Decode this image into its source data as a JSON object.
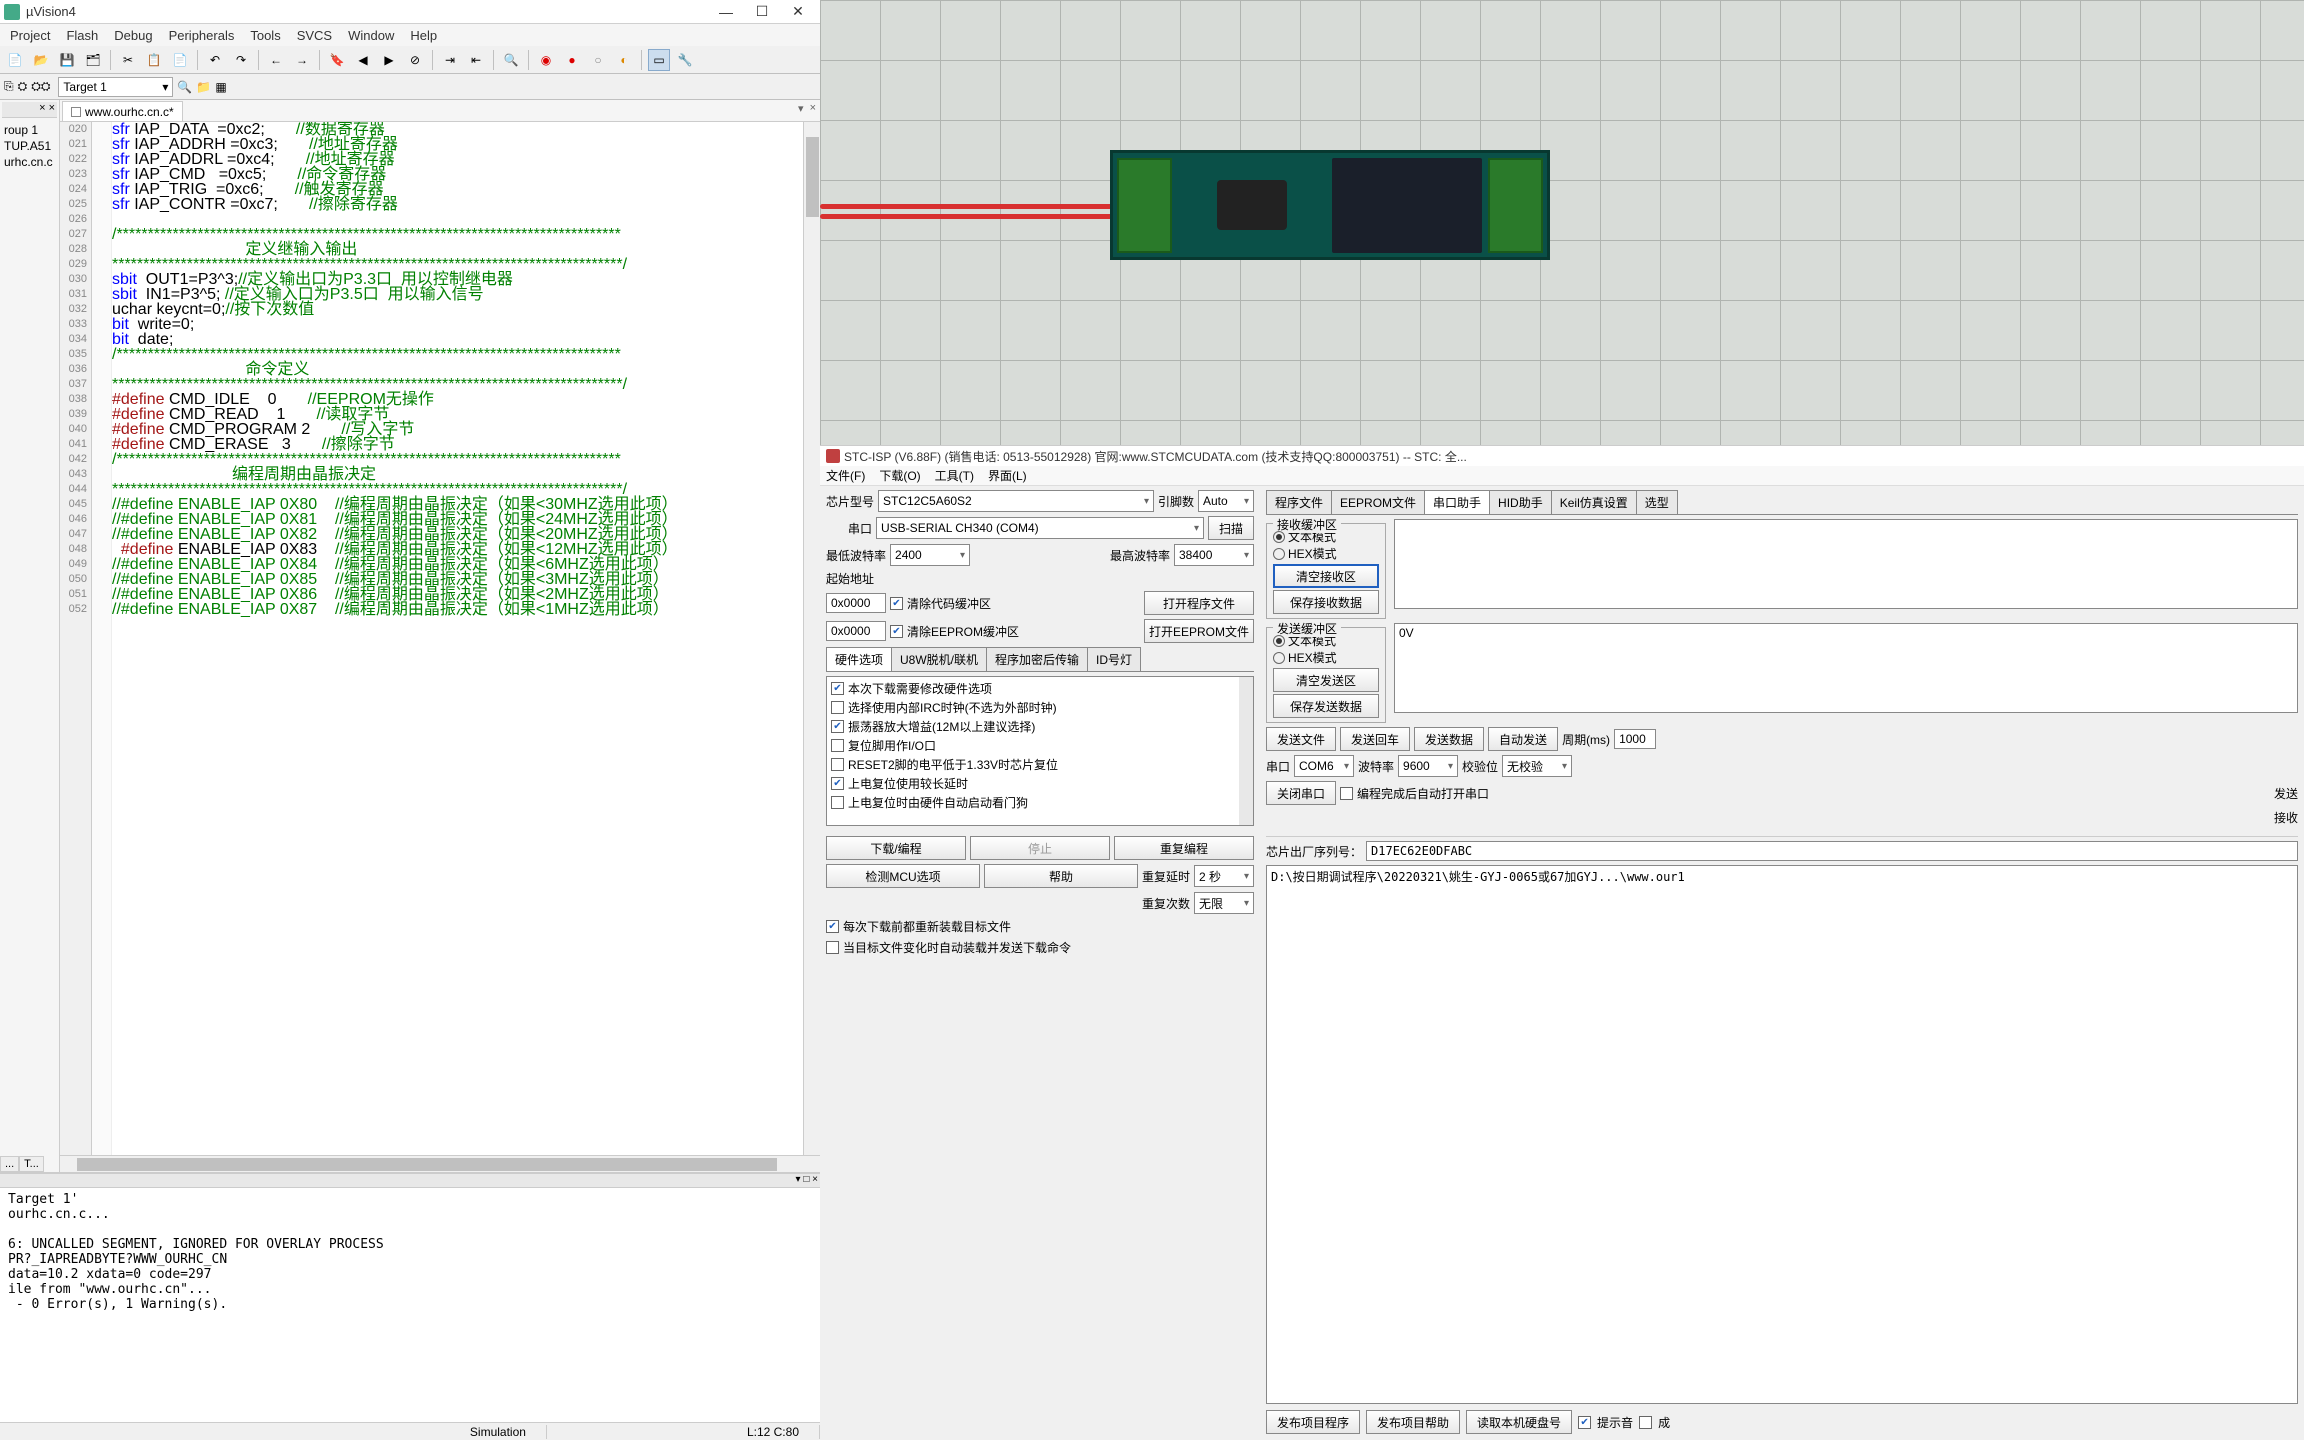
{
  "uvision": {
    "title": "µVision4",
    "menus": [
      "Project",
      "Flash",
      "Debug",
      "Peripherals",
      "Tools",
      "SVCS",
      "Window",
      "Help"
    ],
    "target": "Target 1",
    "editor_tab": "www.ourhc.cn.c*",
    "project_items": [
      "roup 1",
      "TUP.A51",
      "urhc.cn.c"
    ],
    "project_tabs": [
      "...",
      "T..."
    ],
    "code_lines": [
      {
        "n": "020",
        "html": "<span class='kw'>sfr</span> IAP_DATA  =0xc2;       <span class='cm'>//数据寄存器</span>"
      },
      {
        "n": "021",
        "html": "<span class='kw'>sfr</span> IAP_ADDRH =0xc3;       <span class='cm'>//地址寄存器</span>"
      },
      {
        "n": "022",
        "html": "<span class='kw'>sfr</span> IAP_ADDRL =0xc4;       <span class='cm'>//地址寄存器</span>"
      },
      {
        "n": "023",
        "html": "<span class='kw'>sfr</span> IAP_CMD   =0xc5;       <span class='cm'>//命令寄存器</span>"
      },
      {
        "n": "024",
        "html": "<span class='kw'>sfr</span> IAP_TRIG  =0xc6;       <span class='cm'>//触发寄存器</span>"
      },
      {
        "n": "025",
        "html": "<span class='kw'>sfr</span> IAP_CONTR =0xc7;       <span class='cm'>//擦除寄存器</span>"
      },
      {
        "n": "026",
        "html": ""
      },
      {
        "n": "027",
        "html": "<span class='cm'>/*********************************************************************************</span>"
      },
      {
        "n": "028",
        "html": "<span class='cm'>                              定义继输入输出</span>"
      },
      {
        "n": "029",
        "html": "<span class='cm'>**********************************************************************************/</span>"
      },
      {
        "n": "030",
        "html": "<span class='kw'>sbit</span>  OUT1=P3^3;<span class='cm'>//定义输出口为P3.3口  用以控制继电器</span>"
      },
      {
        "n": "031",
        "html": "<span class='kw'>sbit</span>  IN1=P3^5; <span class='cm'>//定义输入口为P3.5口  用以输入信号</span>"
      },
      {
        "n": "032",
        "html": "uchar keycnt=0;<span class='cm'>//按下次数值</span>"
      },
      {
        "n": "033",
        "html": "<span class='kw'>bit</span>  write=0;"
      },
      {
        "n": "034",
        "html": "<span class='kw'>bit</span>  date;"
      },
      {
        "n": "035",
        "html": "<span class='cm'>/*********************************************************************************</span>"
      },
      {
        "n": "036",
        "html": "<span class='cm'>                              命令定义</span>"
      },
      {
        "n": "037",
        "html": "<span class='cm'>**********************************************************************************/</span>"
      },
      {
        "n": "038",
        "html": "<span class='pp'>#define</span> CMD_IDLE    0       <span class='cm'>//EEPROM无操作</span>"
      },
      {
        "n": "039",
        "html": "<span class='pp'>#define</span> CMD_READ    1       <span class='cm'>//读取字节</span>"
      },
      {
        "n": "040",
        "html": "<span class='pp'>#define</span> CMD_PROGRAM 2       <span class='cm'>//写入字节</span>"
      },
      {
        "n": "041",
        "html": "<span class='pp'>#define</span> CMD_ERASE   3       <span class='cm'>//擦除字节</span>"
      },
      {
        "n": "042",
        "html": "<span class='cm'>/*********************************************************************************</span>"
      },
      {
        "n": "043",
        "html": "<span class='cm'>                           编程周期由晶振决定</span>"
      },
      {
        "n": "044",
        "html": "<span class='cm'>**********************************************************************************/</span>"
      },
      {
        "n": "045",
        "html": "<span class='cm'>//#define ENABLE_IAP 0X80    //编程周期由晶振决定（如果&lt;30MHZ选用此项）</span>"
      },
      {
        "n": "046",
        "html": "<span class='cm'>//#define ENABLE_IAP 0X81    //编程周期由晶振决定（如果&lt;24MHZ选用此项）</span>"
      },
      {
        "n": "047",
        "html": "<span class='cm'>//#define ENABLE_IAP 0X82    //编程周期由晶振决定（如果&lt;20MHZ选用此项）</span>"
      },
      {
        "n": "048",
        "html": "  <span class='pp'>#define</span> ENABLE_IAP 0X83    <span class='cm'>//编程周期由晶振决定（如果&lt;12MHZ选用此项）</span>"
      },
      {
        "n": "049",
        "html": "<span class='cm'>//#define ENABLE_IAP 0X84    //编程周期由晶振决定（如果&lt;6MHZ选用此项）</span>"
      },
      {
        "n": "050",
        "html": "<span class='cm'>//#define ENABLE_IAP 0X85    //编程周期由晶振决定（如果&lt;3MHZ选用此项）</span>"
      },
      {
        "n": "051",
        "html": "<span class='cm'>//#define ENABLE_IAP 0X86    //编程周期由晶振决定（如果&lt;2MHZ选用此项）</span>"
      },
      {
        "n": "052",
        "html": "<span class='cm'>//#define ENABLE_IAP 0X87    //编程周期由晶振决定（如果&lt;1MHZ选用此项）</span>"
      }
    ],
    "output": "Target 1'\nourhc.cn.c...\n\n6: UNCALLED SEGMENT, IGNORED FOR OVERLAY PROCESS\nPR?_IAPREADBYTE?WWW_OURHC_CN\ndata=10.2 xdata=0 code=297\nile from \"www.ourhc.cn\"...\n - 0 Error(s), 1 Warning(s).",
    "status_sim": "Simulation",
    "status_pos": "L:12 C:80"
  },
  "stc": {
    "title": "STC-ISP (V6.88F) (销售电话: 0513-55012928) 官网:www.STCMCUDATA.com  (技术支持QQ:800003751) -- STC: 全...",
    "menus": [
      "文件(F)",
      "下载(O)",
      "工具(T)",
      "界面(L)"
    ],
    "chip_label": "芯片型号",
    "chip_value": "STC12C5A60S2",
    "pin_label": "引脚数",
    "pin_value": "Auto",
    "port_label": "串口",
    "port_value": "USB-SERIAL CH340 (COM4)",
    "scan_btn": "扫描",
    "minbaud_label": "最低波特率",
    "minbaud_value": "2400",
    "maxbaud_label": "最高波特率",
    "maxbaud_value": "38400",
    "startaddr_label": "起始地址",
    "addr1": "0x0000",
    "clear_code": "清除代码缓冲区",
    "open_code_btn": "打开程序文件",
    "addr2": "0x0000",
    "clear_eeprom": "清除EEPROM缓冲区",
    "open_eeprom_btn": "打开EEPROM文件",
    "hw_tabs": [
      "硬件选项",
      "U8W脱机/联机",
      "程序加密后传输",
      "ID号灯"
    ],
    "hw_opts": [
      {
        "c": true,
        "t": "本次下载需要修改硬件选项"
      },
      {
        "c": false,
        "t": "选择使用内部IRC时钟(不选为外部时钟)"
      },
      {
        "c": true,
        "t": "振荡器放大增益(12M以上建议选择)"
      },
      {
        "c": false,
        "t": "复位脚用作I/O口"
      },
      {
        "c": false,
        "t": "RESET2脚的电平低于1.33V时芯片复位"
      },
      {
        "c": true,
        "t": "上电复位使用较长延时"
      },
      {
        "c": false,
        "t": "上电复位时由硬件自动启动看门狗"
      }
    ],
    "dl_btn": "下载/编程",
    "stop_btn": "停止",
    "reprg_btn": "重复编程",
    "detect_btn": "检测MCU选项",
    "help_btn": "帮助",
    "redelay_label": "重复延时",
    "redelay_value": "2 秒",
    "recnt_label": "重复次数",
    "recnt_value": "无限",
    "cb_reload": "每次下载前都重新装载目标文件",
    "cb_autodl": "当目标文件变化时自动装载并发送下载命令",
    "right_tabs": [
      "程序文件",
      "EEPROM文件",
      "串口助手",
      "HID助手",
      "Keil仿真设置",
      "选型"
    ],
    "rx_group": "接收缓冲区",
    "txt_mode": "文本模式",
    "hex_mode": "HEX模式",
    "clear_rx_btn": "清空接收区",
    "save_rx_btn": "保存接收数据",
    "tx_group": "发送缓冲区",
    "tx_content": "0V",
    "clear_tx_btn": "清空发送区",
    "save_tx_btn": "保存发送数据",
    "send_file": "发送文件",
    "send_cr": "发送回车",
    "send_data": "发送数据",
    "auto_send": "自动发送",
    "period_label": "周期(ms)",
    "period_value": "1000",
    "com_label": "串口",
    "com_value": "COM6",
    "baud_label": "波特率",
    "baud_value": "9600",
    "parity_label": "校验位",
    "parity_value": "无校验",
    "close_com": "关闭串口",
    "cb_autoopen": "编程完成后自动打开串口",
    "send_sum": "发送",
    "recv_sum": "接收",
    "serial_label": "芯片出厂序列号：",
    "serial_value": "D17EC62E0DFABC",
    "path": "D:\\按日期调试程序\\20220321\\姚生-GYJ-0065或67加GYJ...\\www.our1",
    "footer_btns": [
      "发布项目程序",
      "发布项目帮助",
      "读取本机硬盘号"
    ],
    "cb_hint": "提示音",
    "cb_ok": "成"
  }
}
